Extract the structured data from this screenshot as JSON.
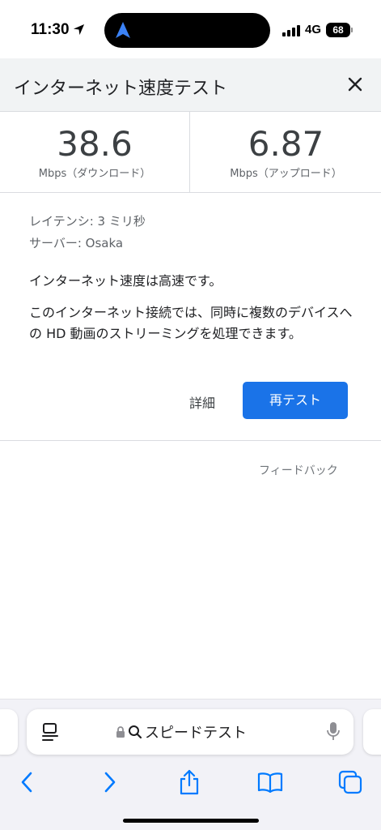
{
  "status_bar": {
    "time": "11:30",
    "network": "4G",
    "battery": "68",
    "icons": [
      "location-arrow-icon",
      "signal-bars-icon",
      "battery-icon"
    ]
  },
  "header": {
    "title": "インターネット速度テスト",
    "close_icon": "close-icon"
  },
  "speeds": {
    "download": {
      "value": "38.6",
      "unit": "Mbps（ダウンロード）"
    },
    "upload": {
      "value": "6.87",
      "unit": "Mbps（アップロード）"
    }
  },
  "details": {
    "latency": "レイテンシ: 3 ミリ秒",
    "server": "サーバー: Osaka",
    "summary": "インターネット速度は高速です。",
    "description": "このインターネット接続では、同時に複数のデバイスへの HD 動画のストリーミングを処理できます。",
    "details_label": "詳細",
    "retest_label": "再テスト"
  },
  "feedback_label": "フィードバック",
  "browser": {
    "address_text": "スピードテスト",
    "icons": [
      "reader-icon",
      "lock-icon",
      "search-icon",
      "mic-icon"
    ],
    "toolbar_icons": [
      "back-icon",
      "forward-icon",
      "share-icon",
      "bookmarks-icon",
      "tabs-icon"
    ]
  },
  "colors": {
    "accent": "#1a73e8",
    "safari_blue": "#007aff",
    "header_bg": "#f1f3f4"
  }
}
